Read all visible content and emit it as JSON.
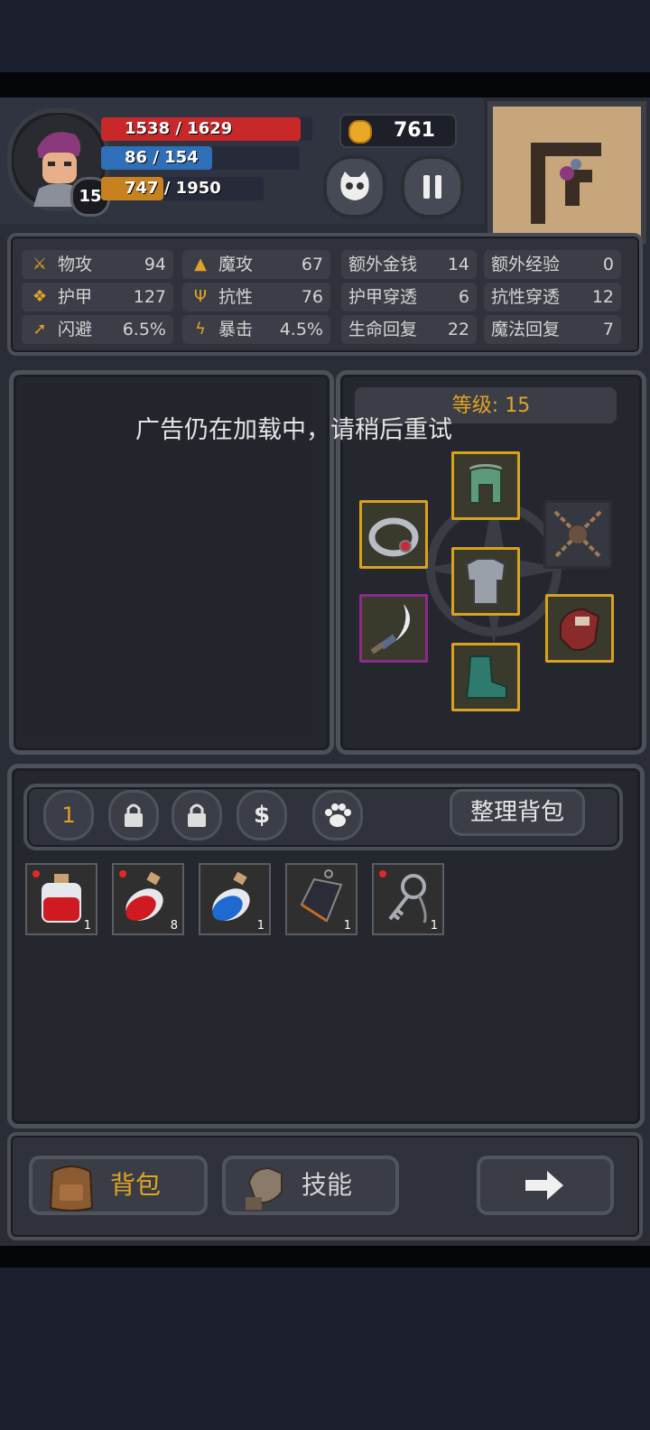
{
  "hud": {
    "level": "15",
    "hp": {
      "current": 1538,
      "max": 1629,
      "text": "1538 / 1629",
      "fraction": 0.944
    },
    "mp": {
      "current": 86,
      "max": 154,
      "text": "86 / 154",
      "fraction": 0.558
    },
    "xp": {
      "current": 747,
      "max": 1950,
      "text": "747 / 1950",
      "fraction": 0.383
    },
    "gold": "761",
    "pet_icon": "skull-face-icon",
    "pause_icon": "pause-icon"
  },
  "stats": [
    {
      "icon": "sword-icon",
      "label": "物攻",
      "value": "94"
    },
    {
      "icon": "magic-hat-icon",
      "label": "魔攻",
      "value": "67"
    },
    {
      "icon": "",
      "label": "额外金钱",
      "value": "14"
    },
    {
      "icon": "",
      "label": "额外经验",
      "value": "0"
    },
    {
      "icon": "paw-icon",
      "label": "护甲",
      "value": "127"
    },
    {
      "icon": "muscle-icon",
      "label": "抗性",
      "value": "76"
    },
    {
      "icon": "",
      "label": "护甲穿透",
      "value": "6"
    },
    {
      "icon": "",
      "label": "抗性穿透",
      "value": "12"
    },
    {
      "icon": "running-icon",
      "label": "闪避",
      "value": "6.5%"
    },
    {
      "icon": "lightning-icon",
      "label": "暴击",
      "value": "4.5%"
    },
    {
      "icon": "",
      "label": "生命回复",
      "value": "22"
    },
    {
      "icon": "",
      "label": "魔法回复",
      "value": "7"
    }
  ],
  "ad_message": "广告仍在加载中，请稍后重试",
  "equipment": {
    "level_label": "等级: 15",
    "slots": [
      "helmet",
      "ring",
      "amulet",
      "armor",
      "weapon",
      "gloves",
      "boots"
    ]
  },
  "inventory": {
    "tabs": [
      "1",
      "lock",
      "lock",
      "$",
      "paw"
    ],
    "sort_label": "整理背包",
    "items": [
      {
        "name": "red-potion-small",
        "count": "1",
        "new": true
      },
      {
        "name": "red-potion",
        "count": "8",
        "new": true
      },
      {
        "name": "blue-potion",
        "count": "1",
        "new": false
      },
      {
        "name": "dark-crystal",
        "count": "1",
        "new": false
      },
      {
        "name": "key-ring",
        "count": "1",
        "new": true
      }
    ]
  },
  "bottom_nav": {
    "bag_label": "背包",
    "skills_label": "技能",
    "next_icon": "arrow-right-icon"
  },
  "colors": {
    "hp": "#c8282a",
    "mp": "#2f6fb8",
    "xp": "#c7821f",
    "accent": "#e2a324"
  }
}
